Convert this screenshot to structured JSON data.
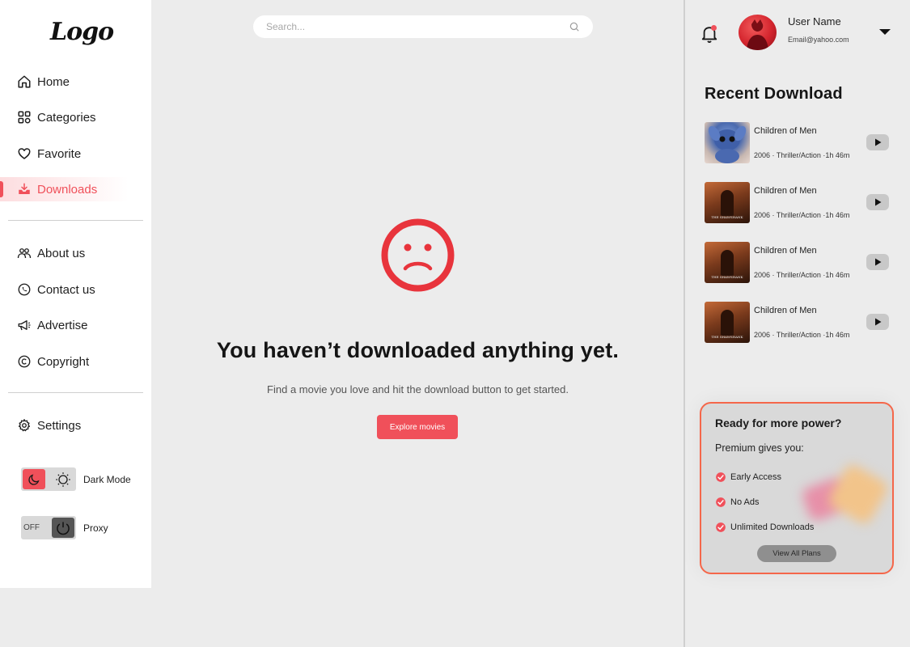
{
  "sidebar": {
    "logo": "Logo",
    "nav_primary": [
      {
        "label": "Home",
        "icon": "home-icon"
      },
      {
        "label": "Categories",
        "icon": "grid-icon"
      },
      {
        "label": "Favorite",
        "icon": "heart-icon"
      },
      {
        "label": "Downloads",
        "icon": "download-icon",
        "active": true
      }
    ],
    "nav_secondary": [
      {
        "label": "About us",
        "icon": "people-icon"
      },
      {
        "label": "Contact us",
        "icon": "phone-icon"
      },
      {
        "label": "Advertise",
        "icon": "megaphone-icon"
      },
      {
        "label": "Copyright",
        "icon": "copyright-icon"
      }
    ],
    "settings_label": "Settings",
    "dark_mode_label": "Dark Mode",
    "proxy_label": "Proxy",
    "proxy_state": "OFF"
  },
  "search": {
    "placeholder": "Search..."
  },
  "empty_state": {
    "title": "You haven’t downloaded anything yet.",
    "subtitle": "Find a movie you love and hit the download button to get started.",
    "button": "Explore movies"
  },
  "user": {
    "name": "User Name",
    "email": "Email@yahoo.com"
  },
  "recent": {
    "title": "Recent Download",
    "items": [
      {
        "title": "Children of Men",
        "meta": "2006 · Thriller/Action ·1h 46m",
        "poster_caption": ""
      },
      {
        "title": "Children of Men",
        "meta": "2006 · Thriller/Action ·1h 46m",
        "poster_caption": "THE SHAWSHANK"
      },
      {
        "title": "Children of Men",
        "meta": "2006 · Thriller/Action ·1h 46m",
        "poster_caption": "THE SHAWSHANK"
      },
      {
        "title": "Children of Men",
        "meta": "2006 · Thriller/Action ·1h 46m",
        "poster_caption": "THE SHAWSHANK"
      }
    ]
  },
  "premium": {
    "title": "Ready for more power?",
    "subtitle": "Premium gives you:",
    "perks": [
      "Early Access",
      "No Ads",
      "Unlimited Downloads"
    ],
    "button": "View All Plans"
  },
  "colors": {
    "accent": "#f0505a",
    "premium_border": "#f5674a",
    "background": "#ececec"
  }
}
